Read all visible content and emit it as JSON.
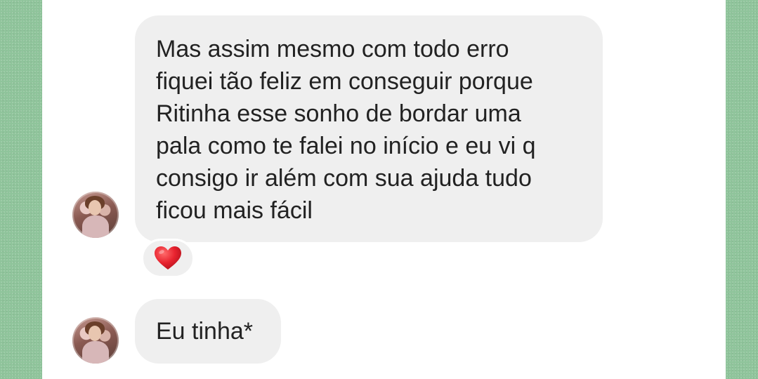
{
  "messages": [
    {
      "sender": "contact",
      "lines": [
        "Mas assim mesmo com todo erro",
        "fiquei tão feliz em conseguir porque",
        "Ritinha esse sonho de bordar uma",
        "pala como te falei no início e eu vi q",
        "consigo ir além com sua ajuda tudo",
        "ficou mais fácil"
      ],
      "reaction": "heart-icon"
    },
    {
      "sender": "contact",
      "text": "Eu tinha*"
    }
  ],
  "colors": {
    "background_edge": "#8fc49b",
    "chat_background": "#ffffff",
    "bubble": "#efefef",
    "text": "#222222",
    "heart": "#e8232f"
  }
}
